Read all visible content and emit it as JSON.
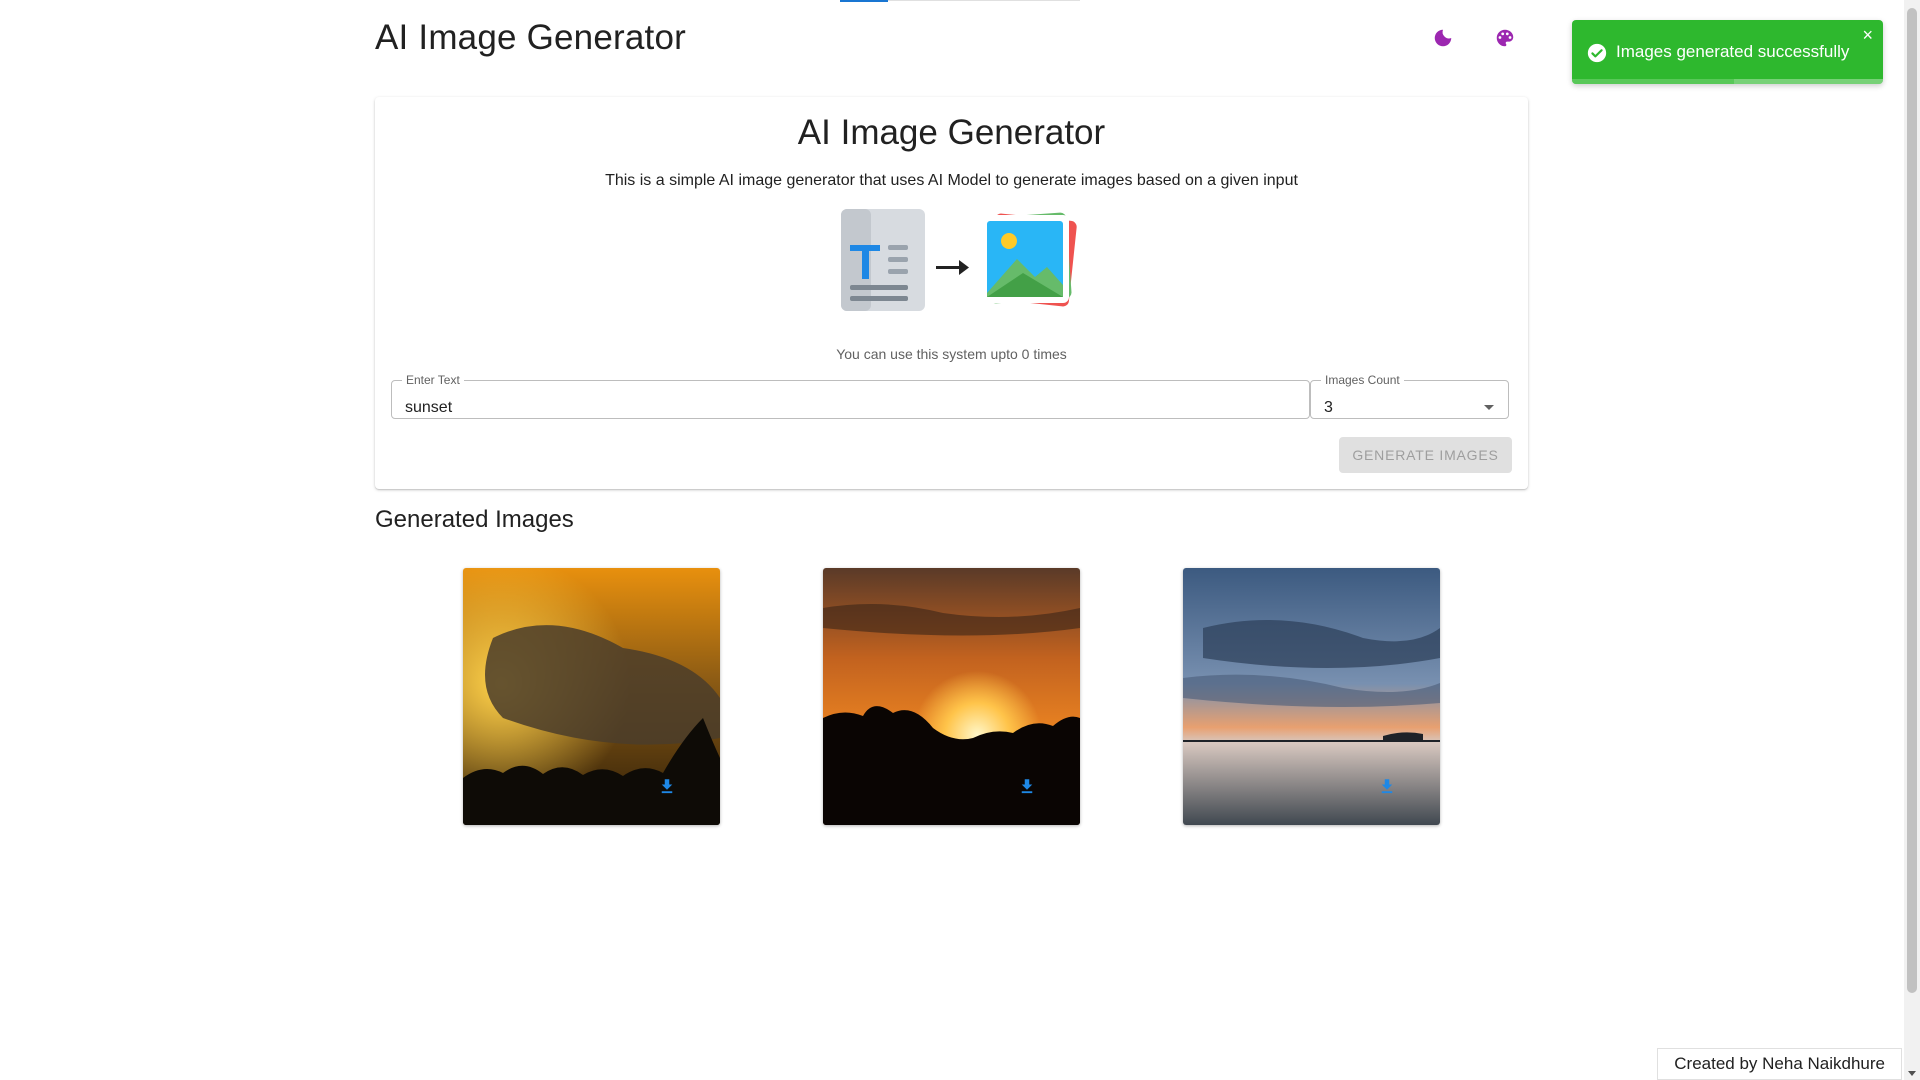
{
  "header": {
    "app_title": "AI Image Generator",
    "dark_mode_icon": "moon-icon",
    "theme_icon": "palette-icon",
    "accent_color": "#9c27b0"
  },
  "toast": {
    "message": "Images generated successfully",
    "close_label": "×",
    "progress": 0.52,
    "color": "#2eb82e"
  },
  "generator_card": {
    "title": "AI Image Generator",
    "description": "This is a simple AI image generator that uses AI Model to generate images based on a given input",
    "usage_note": "You can use this system upto 0 times",
    "text_field": {
      "label": "Enter Text",
      "value": "sunset"
    },
    "count_field": {
      "label": "Images Count",
      "value": "3"
    },
    "generate_button": "GENERATE IMAGES"
  },
  "results": {
    "title": "Generated Images",
    "images": [
      {
        "name": "sunset-image-1",
        "download_icon": "download-icon"
      },
      {
        "name": "sunset-image-2",
        "download_icon": "download-icon"
      },
      {
        "name": "sunset-image-3",
        "download_icon": "download-icon"
      }
    ]
  },
  "footer": {
    "credit": "Created by Neha Naikdhure"
  }
}
